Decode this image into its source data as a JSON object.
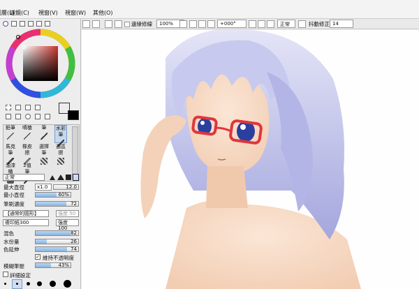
{
  "menu": {
    "items": [
      "圖層(L)",
      "濾鏡(C)",
      "視窗(V)",
      "視窗(W)",
      "其他(O)"
    ]
  },
  "toolbar": {
    "antialias_label": "邊緣修線",
    "zoom": "100%",
    "rotation": "+000°",
    "mode": "正常",
    "stabilizer_label": "抖動修正",
    "stabilizer_value": "14"
  },
  "tools": {
    "row1": [
      "鉛筆",
      "噴槍",
      "筆",
      "水彩筆"
    ],
    "row2": [
      "馬克筆",
      "橡皮擦",
      "選擇筆",
      "選區擦"
    ],
    "row3": [
      "油漆桶",
      "2值筆"
    ]
  },
  "brush": {
    "blend_mode": "正常",
    "max_size_label": "最大直徑",
    "max_size_multiplier": "x1.0",
    "max_size_value": "12.0",
    "min_size_label": "最小直徑",
    "min_size_value": "60%",
    "min_size_fill": 0.6,
    "density_label": "筆刷濃度",
    "density_value": "72",
    "density_fill": 0.72,
    "shape": "【通常的圓形】",
    "shape_strength_label": "強度",
    "shape_strength_value": "50",
    "texture": "複印紙300",
    "texture_strength_label": "強度",
    "texture_strength_value": "100",
    "blend_label": "混色",
    "blend_value": "82",
    "blend_fill": 0.82,
    "water_label": "水份量",
    "water_value": "26",
    "water_fill": 0.26,
    "color_extend_label": "色延伸",
    "color_extend_value": "74",
    "color_extend_fill": 0.74,
    "keep_opacity_label": "維持不透明度",
    "blur_label": "模糊筆壓",
    "blur_value": "43%",
    "blur_fill": 0.43,
    "detail_label": "詳細設定"
  },
  "colors": {
    "primary": "#ffffff",
    "secondary": "#000000",
    "hair": "#b9bce8",
    "glasses": "#e0363c",
    "eye": "#2b3f9e",
    "skin": "#f6d8c2"
  }
}
